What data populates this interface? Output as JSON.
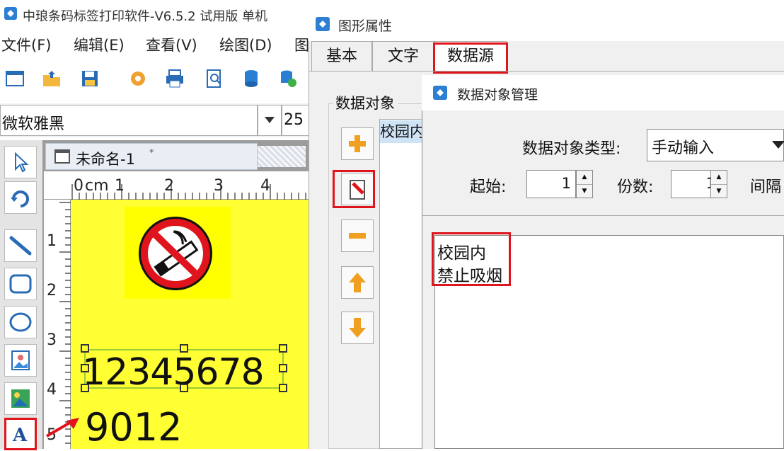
{
  "app": {
    "title": "中琅条码标签打印软件-V6.5.2 试用版 单机",
    "menu": [
      "文件(F)",
      "编辑(E)",
      "查看(V)",
      "绘图(D)",
      "图"
    ],
    "font_name": "微软雅黑",
    "font_size": "25",
    "doc_tab": "未命名-1",
    "doc_tab_marker": "*",
    "ruler_top": [
      "0",
      "cm",
      "1",
      "2",
      "3",
      "4"
    ],
    "ruler_left": [
      "1",
      "2",
      "3",
      "4",
      "5"
    ],
    "label": {
      "barcode_text": "12345678",
      "text2": "9012",
      "background_color": "#ffff33"
    }
  },
  "props": {
    "title": "图形属性",
    "tabs": [
      "基本",
      "文字",
      "数据源"
    ],
    "active_tab": "数据源",
    "group_label": "数据对象",
    "object_item": "校园内",
    "side_buttons": [
      "add-icon",
      "edit-icon",
      "remove-icon",
      "up-icon",
      "down-icon"
    ]
  },
  "manager": {
    "title": "数据对象管理",
    "type_label": "数据对象类型:",
    "type_value": "手动输入",
    "start_label": "起始:",
    "start_value": "1",
    "copies_label": "份数:",
    "copies_value": "1",
    "interval_label": "间隔",
    "content_lines": [
      "校园内",
      "禁止吸烟"
    ]
  },
  "colors": {
    "highlight": "#e0141c",
    "label_yellow": "#ffff33",
    "selection": "#cfe3f7"
  }
}
